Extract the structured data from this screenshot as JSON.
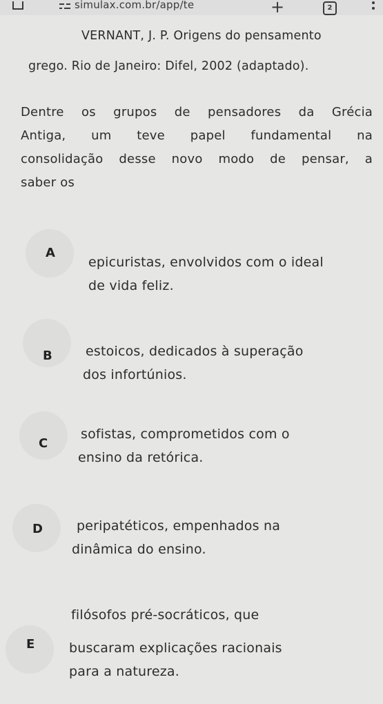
{
  "browser": {
    "url": "simulax.com.br/app/te",
    "tab_count": "2"
  },
  "reference": {
    "line1": "VERNANT, J. P. Origens do pensamento",
    "line2": "grego. Rio de Janeiro: Difel, 2002 (adaptado)."
  },
  "question": {
    "lines": [
      "Dentre os grupos de pensadores da Grécia",
      "Antiga, um teve papel fundamental na",
      "consolidação desse novo modo de pensar, a",
      "saber os"
    ]
  },
  "options": [
    {
      "letter": "A",
      "lines": [
        "epicuristas, envolvidos com o ideal",
        "de vida feliz."
      ]
    },
    {
      "letter": "B",
      "lines": [
        "estoicos, dedicados à superação",
        "dos infortúnios."
      ]
    },
    {
      "letter": "C",
      "lines": [
        "sofistas, comprometidos com o",
        "ensino da retórica."
      ]
    },
    {
      "letter": "D",
      "lines": [
        "peripatéticos, empenhados na",
        "dinâmica do ensino."
      ]
    },
    {
      "letter": "E",
      "lines": [
        "filósofos pré-socráticos, que",
        "buscaram explicações racionais",
        "para a natureza."
      ]
    }
  ]
}
